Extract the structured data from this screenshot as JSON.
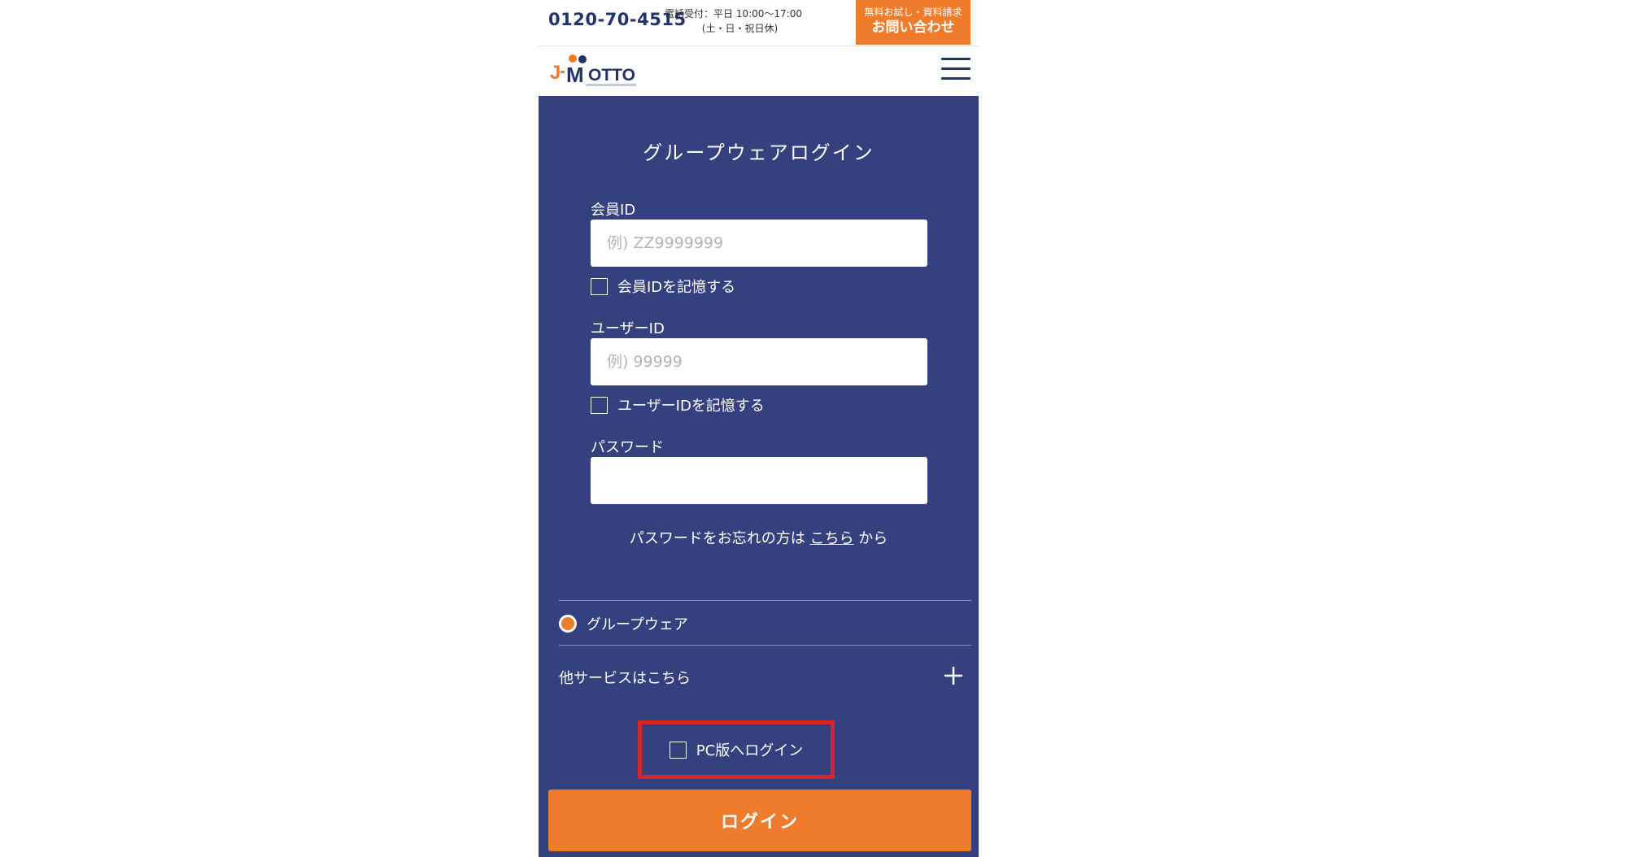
{
  "header": {
    "phone": "0120-70-4515",
    "hours_line1": "電話受付：平日 10:00〜17:00",
    "hours_line2": "(土・日・祝日休)",
    "contact_small": "無料お試し・資料請求",
    "contact_big": "お問い合わせ"
  },
  "logo": {
    "name": "J-MOTTO"
  },
  "colors": {
    "navy": "#35407f",
    "accent": "#ef7b2c",
    "highlight": "#d6262b"
  },
  "form": {
    "title": "グループウェアログイン",
    "member_id_label": "会員ID",
    "member_id_placeholder": "例) ZZ9999999",
    "member_id_value": "",
    "remember_member_id": "会員IDを記憶する",
    "user_id_label": "ユーザーID",
    "user_id_placeholder": "例) 99999",
    "user_id_value": "",
    "remember_user_id": "ユーザーIDを記憶する",
    "password_label": "パスワード",
    "password_value": "",
    "forgot_prefix": "パスワードをお忘れの方は",
    "forgot_link": "こちら",
    "forgot_suffix": "から",
    "service_option": "グループウェア",
    "other_services": "他サービスはこちら",
    "pc_login": "PC版へログイン",
    "login_button": "ログイン"
  },
  "icons": {
    "menu": "hamburger-menu-icon",
    "expand": "plus-icon",
    "logo": "j-motto-logo"
  }
}
